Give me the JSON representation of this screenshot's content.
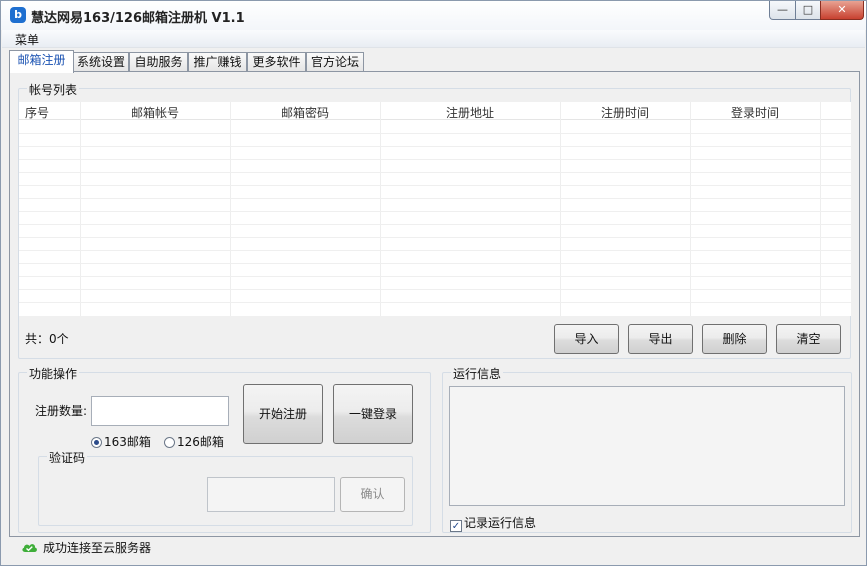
{
  "window": {
    "title": "慧达网易163/126邮箱注册机 V1.1",
    "icon": "app-logo-icon",
    "controls": {
      "minimize": "—",
      "maximize": "□",
      "close": "✕"
    }
  },
  "menu": {
    "items": [
      "菜单"
    ]
  },
  "tabs": [
    "邮箱注册",
    "系统设置",
    "自助服务",
    "推广赚钱",
    "更多软件",
    "官方论坛"
  ],
  "active_tab": "邮箱注册",
  "account_list": {
    "legend": "帐号列表",
    "columns": [
      "序号",
      "邮箱帐号",
      "邮箱密码",
      "注册地址",
      "注册时间",
      "登录时间"
    ],
    "rows": [],
    "count_label": "共：0个",
    "buttons": [
      "导入",
      "导出",
      "删除",
      "清空"
    ]
  },
  "operations": {
    "legend": "功能操作",
    "quantity_label": "注册数量:",
    "quantity_value": "",
    "options": [
      {
        "label": "163邮箱",
        "selected": true
      },
      {
        "label": "126邮箱",
        "selected": false
      }
    ],
    "start_button": "开始注册",
    "login_button": "一键登录",
    "captcha": {
      "legend": "验证码",
      "value": "",
      "confirm_button": "确认"
    }
  },
  "run_info": {
    "legend": "运行信息",
    "log_text": "",
    "record_label": "记录运行信息",
    "record_checked": true
  },
  "status": {
    "icon": "cloud-check-icon",
    "text": "成功连接至云服务器",
    "icon_color": "#3fae3a"
  }
}
